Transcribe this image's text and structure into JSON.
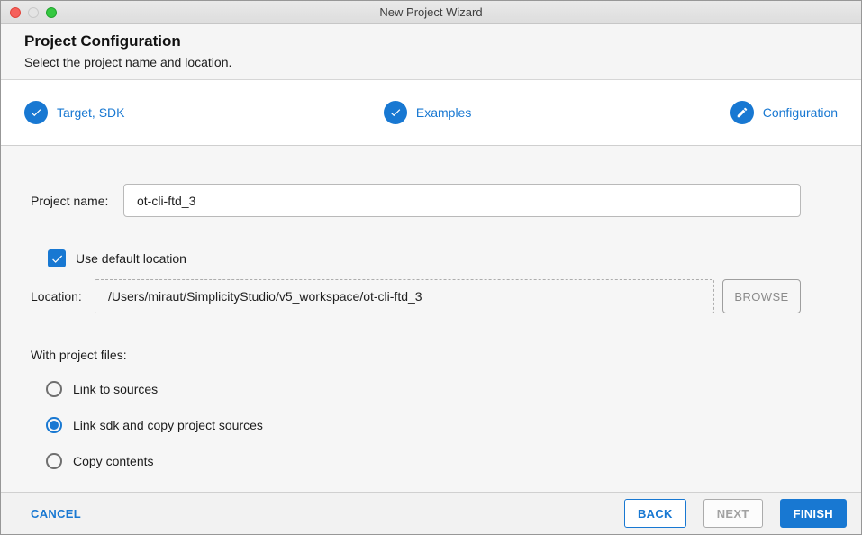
{
  "window": {
    "title": "New Project Wizard"
  },
  "header": {
    "title": "Project Configuration",
    "subtitle": "Select the project name and location."
  },
  "stepper": {
    "steps": [
      {
        "label": "Target, SDK",
        "icon": "check-icon",
        "state": "complete"
      },
      {
        "label": "Examples",
        "icon": "check-icon",
        "state": "complete"
      },
      {
        "label": "Configuration",
        "icon": "pencil-icon",
        "state": "current"
      }
    ]
  },
  "form": {
    "project_name": {
      "label": "Project name:",
      "value": "ot-cli-ftd_3"
    },
    "use_default_location": {
      "label": "Use default location",
      "checked": true
    },
    "location": {
      "label": "Location:",
      "value": "/Users/miraut/SimplicityStudio/v5_workspace/ot-cli-ftd_3",
      "browse_label": "BROWSE"
    },
    "with_project_files": {
      "label": "With project files:",
      "options": [
        {
          "label": "Link to sources",
          "selected": false
        },
        {
          "label": "Link sdk and copy project sources",
          "selected": true
        },
        {
          "label": "Copy contents",
          "selected": false
        }
      ]
    }
  },
  "footer": {
    "cancel_label": "CANCEL",
    "back_label": "BACK",
    "next_label": "NEXT",
    "finish_label": "FINISH"
  },
  "colors": {
    "accent": "#1878d2",
    "disabled_text": "#a2a2a2",
    "close_light": "#f5615c",
    "zoom_light": "#35c841"
  }
}
